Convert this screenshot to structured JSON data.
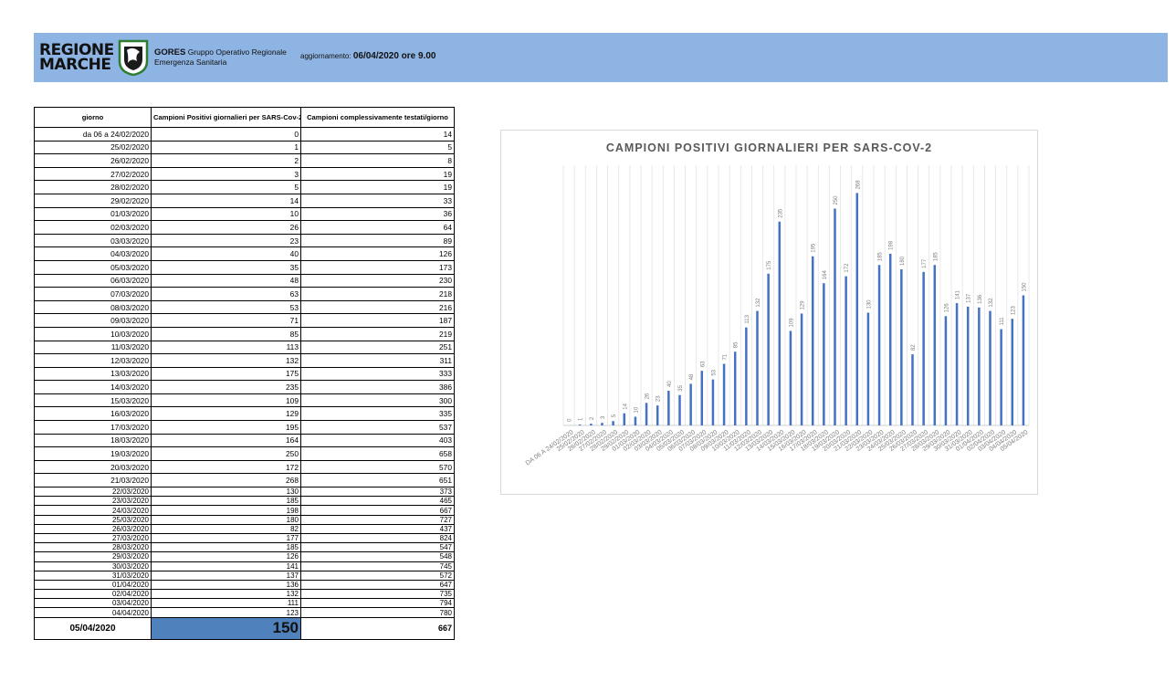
{
  "header": {
    "logo_line1": "REGIONE",
    "logo_line2": "MARCHE",
    "org_short": "GORES",
    "org_line1_rest": "Gruppo Operativo Regionale",
    "org_line2": "Emergenza Sanitaria",
    "update_label": "aggiornamento:",
    "update_value": "06/04/2020 ore 9.00",
    "banner_color": "#8eb4e3"
  },
  "table": {
    "headers": [
      "giorno",
      "Campioni Positivi giornalieri per SARS-Cov-2",
      "Campioni complessivamente testati/giorno"
    ],
    "rows": [
      [
        "da 06 a 24/02/2020",
        "0",
        "14"
      ],
      [
        "25/02/2020",
        "1",
        "5"
      ],
      [
        "26/02/2020",
        "2",
        "8"
      ],
      [
        "27/02/2020",
        "3",
        "19"
      ],
      [
        "28/02/2020",
        "5",
        "19"
      ],
      [
        "29/02/2020",
        "14",
        "33"
      ],
      [
        "01/03/2020",
        "10",
        "36"
      ],
      [
        "02/03/2020",
        "26",
        "64"
      ],
      [
        "03/03/2020",
        "23",
        "89"
      ],
      [
        "04/03/2020",
        "40",
        "126"
      ],
      [
        "05/03/2020",
        "35",
        "173"
      ],
      [
        "06/03/2020",
        "48",
        "230"
      ],
      [
        "07/03/2020",
        "63",
        "218"
      ],
      [
        "08/03/2020",
        "53",
        "216"
      ],
      [
        "09/03/2020",
        "71",
        "187"
      ],
      [
        "10/03/2020",
        "85",
        "219"
      ],
      [
        "11/03/2020",
        "113",
        "251"
      ],
      [
        "12/03/2020",
        "132",
        "311"
      ],
      [
        "13/03/2020",
        "175",
        "333"
      ],
      [
        "14/03/2020",
        "235",
        "386"
      ],
      [
        "15/03/2020",
        "109",
        "300"
      ],
      [
        "16/03/2020",
        "129",
        "335"
      ],
      [
        "17/03/2020",
        "195",
        "537"
      ],
      [
        "18/03/2020",
        "164",
        "403"
      ],
      [
        "19/03/2020",
        "250",
        "658"
      ],
      [
        "20/03/2020",
        "172",
        "570"
      ],
      [
        "21/03/2020",
        "268",
        "651"
      ],
      [
        "22/03/2020",
        "130",
        "373"
      ],
      [
        "23/03/2020",
        "185",
        "465"
      ],
      [
        "24/03/2020",
        "198",
        "667"
      ],
      [
        "25/03/2020",
        "180",
        "727"
      ],
      [
        "26/03/2020",
        "82",
        "437"
      ],
      [
        "27/03/2020",
        "177",
        "824"
      ],
      [
        "28/03/2020",
        "185",
        "547"
      ],
      [
        "29/03/2020",
        "126",
        "548"
      ],
      [
        "30/03/2020",
        "141",
        "745"
      ],
      [
        "31/03/2020",
        "137",
        "572"
      ],
      [
        "01/04/2020",
        "136",
        "647"
      ],
      [
        "02/04/2020",
        "132",
        "735"
      ],
      [
        "03/04/2020",
        "111",
        "794"
      ],
      [
        "04/04/2020",
        "123",
        "780"
      ]
    ],
    "last_row": [
      "05/04/2020",
      "150",
      "667"
    ],
    "highlight_color": "#4f81bd"
  },
  "chart_data": {
    "type": "bar",
    "title": "CAMPIONI POSITIVI GIORNALIERI PER SARS-COV-2",
    "categories": [
      "DA 06 A 24/02/2020",
      "25/02/2020",
      "26/02/2020",
      "27/02/2020",
      "28/02/2020",
      "29/02/2020",
      "01/03/2020",
      "02/03/2020",
      "03/03/2020",
      "04/03/2020",
      "05/03/2020",
      "06/03/2020",
      "07/03/2020",
      "08/03/2020",
      "09/03/2020",
      "10/03/2020",
      "11/03/2020",
      "12/03/2020",
      "13/03/2020",
      "14/03/2020",
      "15/03/2020",
      "16/03/2020",
      "17/03/2020",
      "18/03/2020",
      "19/03/2020",
      "20/03/2020",
      "21/03/2020",
      "22/03/2020",
      "23/03/2020",
      "24/03/2020",
      "25/03/2020",
      "26/03/2020",
      "27/03/2020",
      "28/03/2020",
      "29/03/2020",
      "30/03/2020",
      "31/03/2020",
      "01/04/2020",
      "02/04/2020",
      "03/04/2020",
      "04/04/2020",
      "05/04/2020"
    ],
    "values": [
      0,
      1,
      2,
      3,
      5,
      14,
      10,
      26,
      23,
      40,
      35,
      48,
      63,
      53,
      71,
      85,
      113,
      132,
      175,
      235,
      109,
      129,
      195,
      164,
      250,
      172,
      268,
      130,
      185,
      198,
      180,
      82,
      177,
      185,
      126,
      141,
      137,
      136,
      132,
      111,
      123,
      150
    ],
    "ylim": [
      0,
      300
    ],
    "grid": "vertical",
    "bar_color": "#4472c4",
    "label_color": "#7f7f7f"
  }
}
